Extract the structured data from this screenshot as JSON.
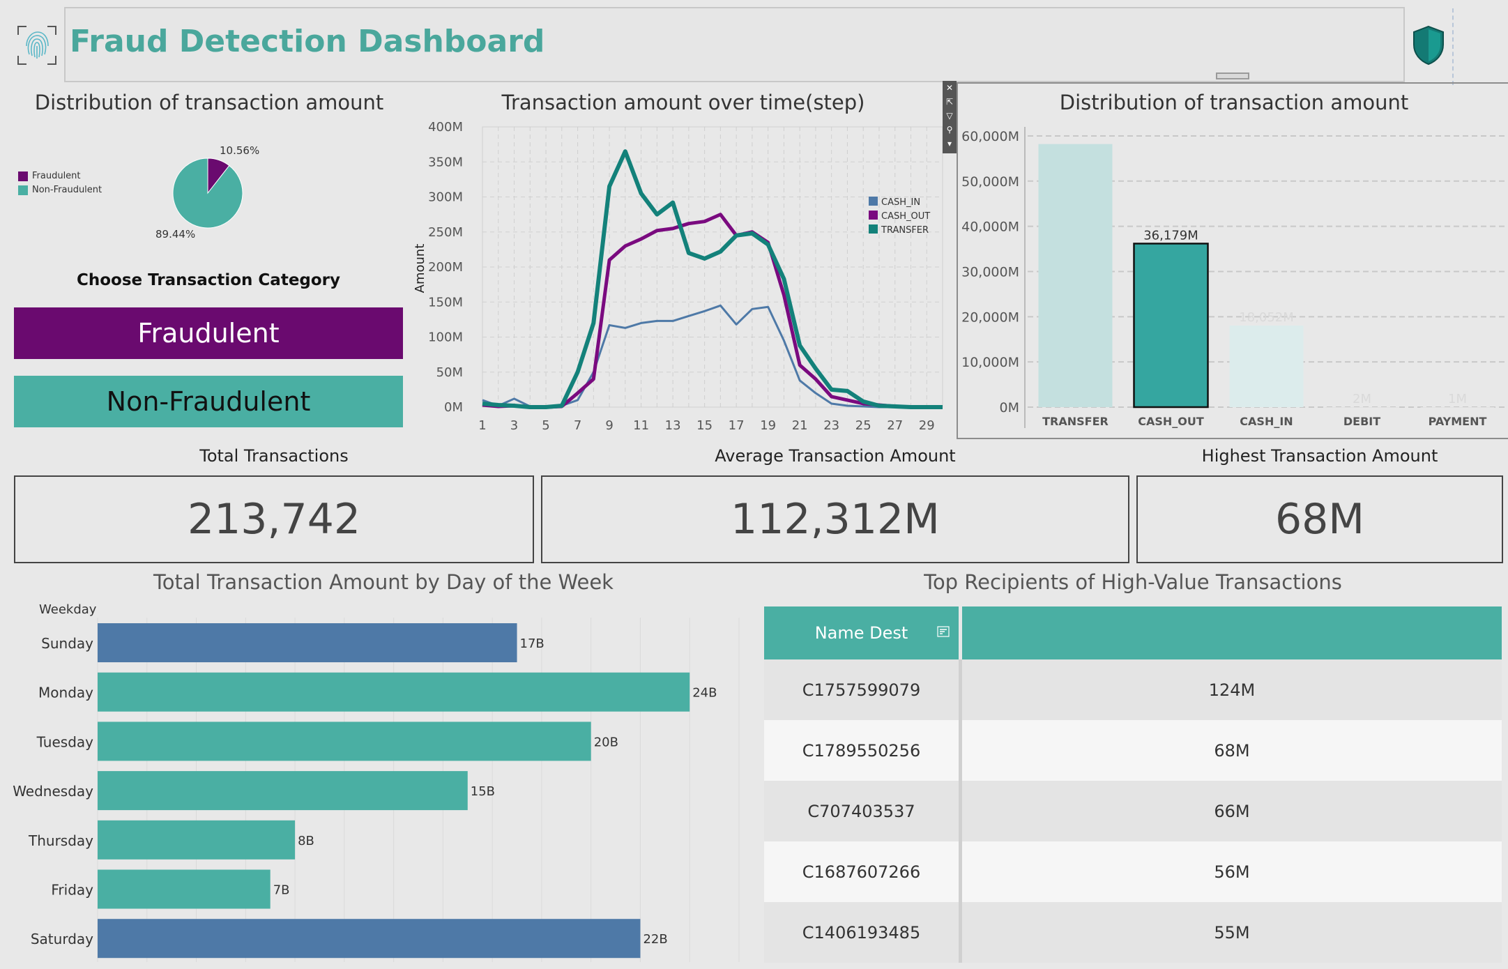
{
  "header": {
    "title": "Fraud Detection Dashboard",
    "logo_icon": "fingerprint-icon",
    "shield_icon": "shield-icon"
  },
  "pie_section": {
    "title": "Distribution of transaction amount",
    "legend": [
      {
        "label": "Fraudulent",
        "color": "#6a0a6f"
      },
      {
        "label": "Non-Fraudulent",
        "color": "#4aafa3"
      }
    ],
    "fraud_pct_label": "10.56%",
    "nonfraud_pct_label": "89.44%"
  },
  "category": {
    "title": "Choose Transaction Category",
    "fraud_button": "Fraudulent",
    "nonfraud_button": "Non-Fraudulent"
  },
  "line_section": {
    "title": "Transaction amount over time(step)",
    "ylabel": "Amount"
  },
  "bar_section": {
    "title": "Distribution of transaction amount"
  },
  "kpis": {
    "total_label": "Total Transactions",
    "total_value": "213,742",
    "avg_label": "Average Transaction Amount",
    "avg_value": "112,312M",
    "high_label": "Highest Transaction Amount",
    "high_value": "68M"
  },
  "weekday_section": {
    "title": "Total Transaction Amount by Day of the Week",
    "axis_header": "Weekday"
  },
  "recipients": {
    "title": "Top Recipients of High-Value Transactions",
    "header": "Name Dest",
    "header2": "",
    "rows": [
      {
        "name": "C1757599079",
        "value": "124M"
      },
      {
        "name": "C1789550256",
        "value": "68M"
      },
      {
        "name": "C707403537",
        "value": "66M"
      },
      {
        "name": "C1687607266",
        "value": "56M"
      },
      {
        "name": "C1406193485",
        "value": "55M"
      }
    ]
  },
  "chart_data": [
    {
      "type": "pie",
      "title": "Distribution of transaction amount",
      "categories": [
        "Fraudulent",
        "Non-Fraudulent"
      ],
      "values": [
        10.56,
        89.44
      ],
      "colors": [
        "#6a0a6f",
        "#4aafa3"
      ],
      "legend": "left"
    },
    {
      "type": "line",
      "title": "Transaction amount over time(step)",
      "xlabel": "",
      "ylabel": "Amount",
      "x": [
        1,
        2,
        3,
        4,
        5,
        6,
        7,
        8,
        9,
        10,
        11,
        12,
        13,
        14,
        15,
        16,
        17,
        18,
        19,
        20,
        21,
        22,
        23,
        24,
        25,
        26,
        27,
        28,
        29,
        30
      ],
      "xticks": [
        1,
        3,
        5,
        7,
        9,
        11,
        13,
        15,
        17,
        19,
        21,
        23,
        25,
        27,
        29
      ],
      "yticks": [
        "0M",
        "50M",
        "100M",
        "150M",
        "200M",
        "250M",
        "300M",
        "350M",
        "400M"
      ],
      "ylim": [
        0,
        400
      ],
      "legend": "right",
      "grid": true,
      "series": [
        {
          "name": "CASH_IN",
          "color": "#4e79a7",
          "width": 3,
          "values": [
            10,
            2,
            12,
            1,
            1,
            2,
            10,
            50,
            117,
            113,
            120,
            123,
            123,
            130,
            137,
            145,
            118,
            140,
            143,
            95,
            38,
            20,
            5,
            2,
            1,
            0,
            0,
            0,
            0,
            0
          ]
        },
        {
          "name": "CASH_OUT",
          "color": "#7a0a7f",
          "width": 5,
          "values": [
            3,
            1,
            2,
            0,
            0,
            1,
            20,
            40,
            210,
            230,
            240,
            252,
            255,
            262,
            265,
            275,
            245,
            250,
            235,
            160,
            60,
            40,
            15,
            10,
            5,
            3,
            1,
            0,
            0,
            0
          ]
        },
        {
          "name": "TRANSFER",
          "color": "#13817a",
          "width": 6,
          "values": [
            5,
            3,
            2,
            0,
            0,
            2,
            50,
            120,
            315,
            365,
            305,
            275,
            292,
            220,
            212,
            222,
            245,
            248,
            232,
            183,
            88,
            55,
            25,
            23,
            8,
            2,
            1,
            0,
            0,
            0
          ]
        }
      ]
    },
    {
      "type": "bar",
      "title": "Distribution of transaction amount",
      "categories": [
        "TRANSFER",
        "CASH_OUT",
        "CASH_IN",
        "DEBIT",
        "PAYMENT"
      ],
      "values": [
        58200,
        36179,
        18052,
        2,
        1
      ],
      "data_labels": [
        "",
        "36,179M",
        "18,052M",
        "2M",
        "1M"
      ],
      "yticks": [
        "0M",
        "10,000M",
        "20,000M",
        "30,000M",
        "40,000M",
        "50,000M",
        "60,000M"
      ],
      "ylim": [
        0,
        62000
      ],
      "grid": true
    },
    {
      "type": "bar",
      "orientation": "horizontal",
      "title": "Total Transaction Amount by Day of the Week",
      "ylabel": "Weekday",
      "categories": [
        "Sunday",
        "Monday",
        "Tuesday",
        "Wednesday",
        "Thursday",
        "Friday",
        "Saturday"
      ],
      "values": [
        17,
        24,
        20,
        15,
        8,
        7,
        22
      ],
      "data_labels": [
        "17B",
        "24B",
        "20B",
        "15B",
        "8B",
        "7B",
        "22B"
      ],
      "colors": [
        "#4e79a7",
        "#4aafa3",
        "#4aafa3",
        "#4aafa3",
        "#4aafa3",
        "#4aafa3",
        "#4e79a7"
      ],
      "xlim": [
        0,
        26
      ]
    }
  ]
}
